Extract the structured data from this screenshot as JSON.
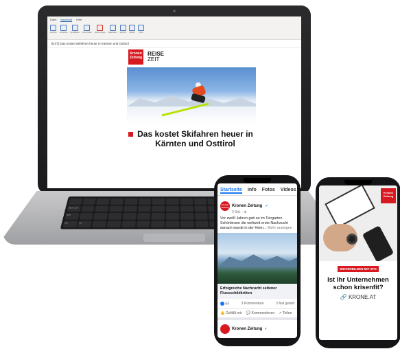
{
  "laptop": {
    "ribbon_tabs": [
      "Datei",
      "Nachricht",
      "Hilfe"
    ],
    "ribbon_active": "Nachricht",
    "ribbon_groups": [
      "Löschen",
      "Antworten",
      "QuickSteps",
      "Verschieben",
      "Markierungen",
      "Bearbeiten",
      "Sprache",
      "Suchen",
      "Zoom"
    ],
    "mail_subject": "[EXT] Das kostet Skifahren heuer in Kärnten und Osttirol",
    "logo_text": "Kronen Zeitung",
    "brand_title": "REISE",
    "brand_subtitle": "ZEIT",
    "headline": "Das kostet Skifahren heuer in Kärnten und Osttirol",
    "keyboard": {
      "caps_lock": "Caps Lock",
      "shift": "Shift",
      "alt": "Alt",
      "ctrl": "Ctrl"
    }
  },
  "phone_facebook": {
    "tabs": [
      "Startseite",
      "Info",
      "Fotos",
      "Videos"
    ],
    "active_tab": "Startseite",
    "page_name": "Kronen Zeitung",
    "post_meta": "3 Std. · ⊕",
    "post_text": "Vor zwölf Jahren gab es im Tiergarten Schönbrunn die weltweit erste Nachzucht danach wurde in der Heim...",
    "more_link": "Mehr anzeigen",
    "photo_caption": "Erfolgreiche Nachzucht seltener Flussschildkröten",
    "likes": "54",
    "comments": "3 Kommentare",
    "shares": "3 Mal geteilt",
    "actions": [
      "Gefällt mir",
      "Kommentieren",
      "Teilen"
    ],
    "second_post_name": "Kronen Zeitung"
  },
  "phone_ad": {
    "logo_text": "Kronen Zeitung",
    "kicker": "WEITERBILDEN MIT SFG",
    "headline": "Ist Ihr Unternehmen schon krisenfit?",
    "link": "KRONE.AT"
  },
  "colors": {
    "brand_red": "#d71920",
    "facebook_blue": "#1877f2",
    "device_dark": "#151517"
  }
}
